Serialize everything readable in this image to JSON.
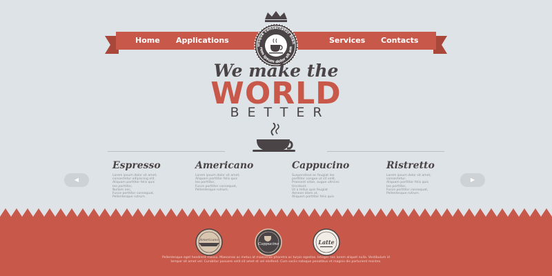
{
  "nav": {
    "items": [
      {
        "label": "Home"
      },
      {
        "label": "Applications"
      },
      {
        "label": "Services"
      },
      {
        "label": "Contacts"
      }
    ]
  },
  "badge": {
    "top_text": "Quisque consectetur blandit",
    "bottom_text": "Lorem ipsum dolor sit amet"
  },
  "hero": {
    "line1": "We make the",
    "line2": "WORLD",
    "line3": "BETTER"
  },
  "columns": [
    {
      "title": "Espresso",
      "items": [
        "Lorem ipsum dolor sit amet,",
        "consectetur adipiscing elit.",
        "Aliquam porttitor felis quis",
        "leo porttitor,",
        "Nullam nec,",
        "Fusce porttitor consequat,",
        "Pellentesque rutrum."
      ]
    },
    {
      "title": "Americano",
      "items": [
        "Lorem ipsum dolor sit amet,",
        "Aliquam porttitor felis quis",
        "leo porttitor,",
        "Fusce porttitor consequat,",
        "Pellentesque rutrum."
      ]
    },
    {
      "title": "Cappucino",
      "items": [
        "Suspendisse ac feugiat leo",
        "porttitor congue ut sit velit,",
        "Praesent vitae, augue ultrices",
        "tincidunt.",
        "Ut a tellus quis feugiat",
        "Aenean diam ut,",
        "Aliquam porttitor felis quis"
      ]
    },
    {
      "title": "Ristretto",
      "items": [
        "Lorem ipsum dolor sit amet,",
        "consectetur.",
        "Aliquam porttitor felis quis",
        "leo porttitor,",
        "Fusce porttitor consequat,",
        "Pellentesque rutrum."
      ]
    }
  ],
  "arrows": {
    "prev": "◀",
    "next": "▶"
  },
  "stamps": [
    {
      "label": "Americano"
    },
    {
      "label": "Cappucino"
    },
    {
      "label": "Latte"
    }
  ],
  "footer": {
    "text": "Pellentesque eget hendrerit massa. Maecenas ac metus at maecenas pharetra ac turpis egestas. Integer nec lorem aliquet nulla. Vestibulum id tempor sit amet vel. Curabitur posuere velit sit amet et vel eleifend. Cum sociis natoque penatibus et magnis dis parturient montes."
  },
  "colors": {
    "background": "#dde3e6",
    "accent": "#c8594a",
    "dark": "#4a4446"
  }
}
